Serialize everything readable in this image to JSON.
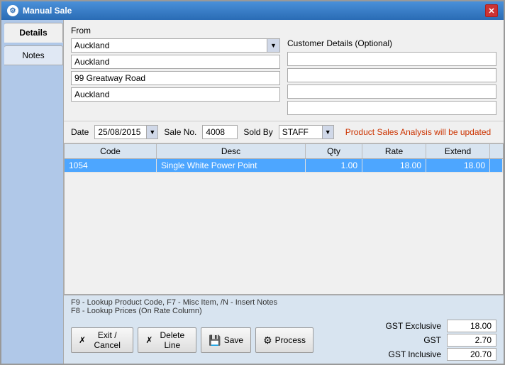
{
  "window": {
    "title": "Manual Sale",
    "icon": "●"
  },
  "tabs": [
    {
      "id": "details",
      "label": "Details",
      "active": true
    },
    {
      "id": "notes",
      "label": "Notes",
      "active": false
    }
  ],
  "from": {
    "label": "From",
    "city_dropdown": "Auckland",
    "address1": "Auckland",
    "address2": "99 Greatway Road",
    "address3": "Auckland"
  },
  "customer": {
    "label": "Customer Details (Optional)",
    "line1": "",
    "line2": "",
    "line3": "",
    "line4": ""
  },
  "date_row": {
    "date_label": "Date",
    "date_value": "25/08/2015",
    "saleno_label": "Sale No.",
    "saleno_value": "4008",
    "soldby_label": "Sold By",
    "soldby_value": "STAFF",
    "analysis_text": "Product Sales Analysis will be updated"
  },
  "table": {
    "columns": [
      "Code",
      "Desc",
      "Qty",
      "Rate",
      "Extend"
    ],
    "rows": [
      {
        "code": "1054",
        "desc": "Single White Power Point",
        "qty": "1.00",
        "rate": "18.00",
        "extend": "18.00",
        "selected": true
      }
    ]
  },
  "footer": {
    "hint1": "F9 - Lookup Product Code,   F7 - Misc Item,   /N - Insert Notes",
    "hint2": "F8 - Lookup Prices (On Rate Column)",
    "buttons": {
      "exit": "Exit / Cancel",
      "delete": "Delete Line",
      "save": "Save",
      "process": "Process"
    },
    "totals": {
      "gst_exclusive_label": "GST Exclusive",
      "gst_exclusive_value": "18.00",
      "gst_label": "GST",
      "gst_value": "2.70",
      "gst_inclusive_label": "GST Inclusive",
      "gst_inclusive_value": "20.70"
    }
  }
}
